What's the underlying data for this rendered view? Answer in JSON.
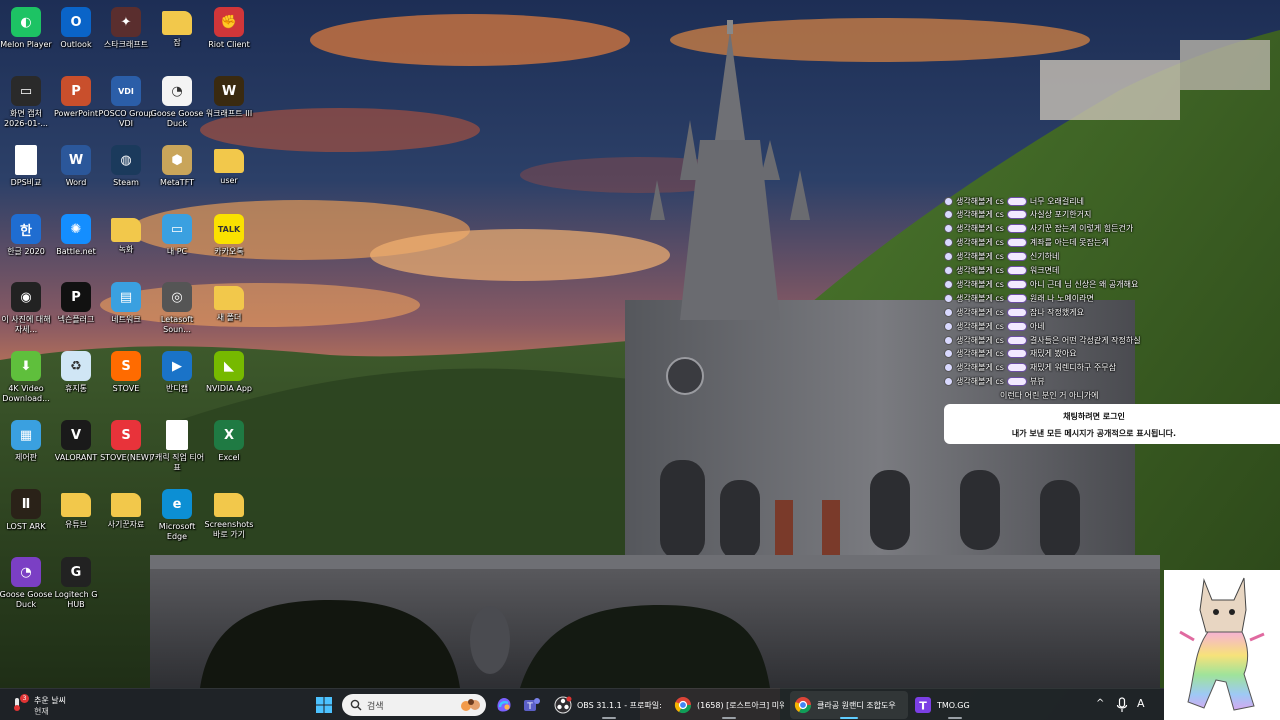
{
  "desktop": {
    "icons": [
      {
        "label": "Melon Player",
        "icon": "melon-player-icon",
        "color": "#1dc364"
      },
      {
        "label": "Outlook",
        "icon": "outlook-icon",
        "color": "#0a64c8"
      },
      {
        "label": "스타크래프트",
        "icon": "starcraft-icon",
        "color": "#5a2e2e"
      },
      {
        "label": "잠",
        "icon": "folder-icon",
        "color": "#f2c84b"
      },
      {
        "label": "Riot Client",
        "icon": "riot-client-icon",
        "color": "#d13639"
      },
      {
        "label": "화면 캡처 2026-01-...",
        "icon": "screenshot-file-icon",
        "color": "#2a2a2a"
      },
      {
        "label": "PowerPoint",
        "icon": "powerpoint-icon",
        "color": "#c94f2c"
      },
      {
        "label": "POSCO Group VDI",
        "icon": "posco-vdi-icon",
        "color": "#2b5ea8"
      },
      {
        "label": "Goose Goose Duck",
        "icon": "goose-goose-duck-icon",
        "color": "#f4f4f4"
      },
      {
        "label": "워크래프트 III",
        "icon": "warcraft-iii-icon",
        "color": "#3a2a10"
      },
      {
        "label": "DPS비교",
        "icon": "document-icon",
        "color": "#ffffff"
      },
      {
        "label": "Word",
        "icon": "word-icon",
        "color": "#2b579a"
      },
      {
        "label": "Steam",
        "icon": "steam-icon",
        "color": "#1b3a5c"
      },
      {
        "label": "MetaTFT",
        "icon": "metatft-icon",
        "color": "#c9a55a"
      },
      {
        "label": "user",
        "icon": "folder-icon",
        "color": "#f2c84b"
      },
      {
        "label": "한글 2020",
        "icon": "hangul-icon",
        "color": "#1f6dd1"
      },
      {
        "label": "Battle.net",
        "icon": "battlenet-icon",
        "color": "#148eff"
      },
      {
        "label": "녹화",
        "icon": "folder-icon",
        "color": "#f2c84b"
      },
      {
        "label": "내 PC",
        "icon": "this-pc-icon",
        "color": "#3aa0e0"
      },
      {
        "label": "카카오톡",
        "icon": "kakaotalk-icon",
        "color": "#fae100"
      },
      {
        "label": "이 사진에 대해 자세...",
        "icon": "learn-about-picture-icon",
        "color": "#222222"
      },
      {
        "label": "넥슨플러그",
        "icon": "nexon-plug-icon",
        "color": "#111111"
      },
      {
        "label": "네트워크",
        "icon": "network-icon",
        "color": "#3aa0e0"
      },
      {
        "label": "Letasoft Soun...",
        "icon": "speaker-icon",
        "color": "#555555"
      },
      {
        "label": "새 폴더",
        "icon": "folder-icon",
        "color": "#f2c84b"
      },
      {
        "label": "4K Video Download...",
        "icon": "4k-video-downloader-icon",
        "color": "#5fbf3c"
      },
      {
        "label": "휴지통",
        "icon": "recycle-bin-icon",
        "color": "#d0e6f5"
      },
      {
        "label": "STOVE",
        "icon": "stove-icon",
        "color": "#ff6b00"
      },
      {
        "label": "반디캠",
        "icon": "bandicam-icon",
        "color": "#1a73c8"
      },
      {
        "label": "NVIDIA App",
        "icon": "nvidia-app-icon",
        "color": "#76b900"
      },
      {
        "label": "제어판",
        "icon": "control-panel-icon",
        "color": "#3aa0e0"
      },
      {
        "label": "VALORANT",
        "icon": "valorant-icon",
        "color": "#1a1a1a"
      },
      {
        "label": "STOVE(NEW)",
        "icon": "stove-new-icon",
        "color": "#e8333a"
      },
      {
        "label": "7캐릭 직업 티어표",
        "icon": "document-icon",
        "color": "#ffffff"
      },
      {
        "label": "Excel",
        "icon": "excel-icon",
        "color": "#1f7a43"
      },
      {
        "label": "LOST ARK",
        "icon": "lost-ark-icon",
        "color": "#2a2218"
      },
      {
        "label": "유튜브",
        "icon": "folder-icon",
        "color": "#f2c84b"
      },
      {
        "label": "사기꾼자료",
        "icon": "folder-icon",
        "color": "#f2c84b"
      },
      {
        "label": "Microsoft Edge",
        "icon": "edge-icon",
        "color": "#0c8fd4"
      },
      {
        "label": "Screenshots 바로 가기",
        "icon": "screenshots-shortcut-icon",
        "color": "#f2c84b"
      },
      {
        "label": "Goose Goose Duck",
        "icon": "goose-goose-duck-purple-icon",
        "color": "#7b3fc4"
      },
      {
        "label": "Logitech G HUB",
        "icon": "logitech-g-hub-icon",
        "color": "#222222"
      }
    ]
  },
  "chat": {
    "messages": [
      {
        "name": "생각해볼게 cs",
        "text": "너무 오래걸리네"
      },
      {
        "name": "생각해볼게 cs",
        "text": "사실상 포기한거지"
      },
      {
        "name": "생각해볼게 cs",
        "text": "사기꾼 잡는게 이렇게 힘든건가"
      },
      {
        "name": "생각해볼게 cs",
        "text": "계좌를 아는데 못잡는게"
      },
      {
        "name": "생각해볼게 cs",
        "text": "신기하네"
      },
      {
        "name": "생각해볼게 cs",
        "text": "워크면데"
      },
      {
        "name": "생각해볼게 cs",
        "text": "아니 근데 님 신상은 왜 공개해요"
      },
      {
        "name": "생각해볼게 cs",
        "text": "원래 나 노예이라면"
      },
      {
        "name": "생각해볼게 cs",
        "text": "잡나 작정했게요"
      },
      {
        "name": "생각해볼게 cs",
        "text": "아네"
      },
      {
        "name": "생각해볼게 cs",
        "text": "결사들은 어떤 각성같게 작정하실"
      },
      {
        "name": "생각해볼게 cs",
        "text": "재밌게 봤아요"
      },
      {
        "name": "생각해볼게 cs",
        "text": "재밌게 워렌디하구 주무삼"
      },
      {
        "name": "생각해볼게 cs",
        "text": "뷰뷰"
      },
      {
        "name": "",
        "text": "이런다 어린 분인 거 아니가에"
      }
    ],
    "notice_title": "채팅하려면 로그인",
    "notice_body": "내가 보낸 모든 메시지가 공개적으로 표시됩니다."
  },
  "taskbar": {
    "weather_temp_badge": "3",
    "weather_line1": "추운 날씨",
    "weather_line2": "현재",
    "search_placeholder": "검색",
    "apps": [
      {
        "icon": "copilot-icon"
      },
      {
        "icon": "teams-icon"
      },
      {
        "icon": "obs-icon",
        "label": "OBS 31.1.1 - 프로파일: 제",
        "active": false
      },
      {
        "icon": "chrome-icon",
        "label": "(1658) [로스트아크] 미워",
        "active": false
      },
      {
        "icon": "chrome-icon",
        "label": "클라공 원랜디 조합도우",
        "active": true
      },
      {
        "icon": "twitch-tmo-icon",
        "label": "TMO.GG",
        "active": false
      }
    ],
    "tray": {
      "chevron": "^",
      "lang": "A"
    }
  },
  "colors": {
    "taskbar_bg": "#1e2128",
    "accent": "#60cdff",
    "chat_tag": "#6b4ea3"
  }
}
